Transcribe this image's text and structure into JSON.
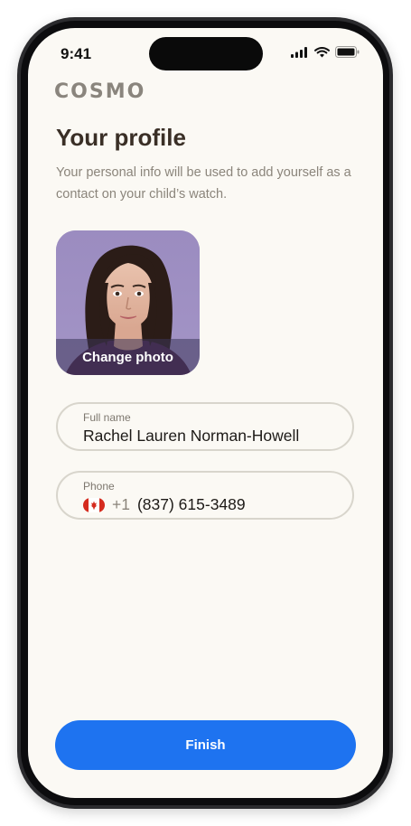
{
  "status_bar": {
    "time": "9:41"
  },
  "brand": {
    "logo": "COSMO"
  },
  "header": {
    "title": "Your profile",
    "subtitle": "Your personal info will be used to add yourself as a contact on your child’s watch."
  },
  "photo": {
    "change_label": "Change photo"
  },
  "full_name": {
    "label": "Full name",
    "value": "Rachel Lauren Norman-Howell"
  },
  "phone": {
    "label": "Phone",
    "country_code": "+1",
    "number": "(837) 615-3489",
    "country_flag": "canada-flag-icon"
  },
  "actions": {
    "finish_label": "Finish"
  },
  "colors": {
    "accent": "#1e73f0",
    "background": "#fbf9f4",
    "title": "#3a2f26"
  }
}
